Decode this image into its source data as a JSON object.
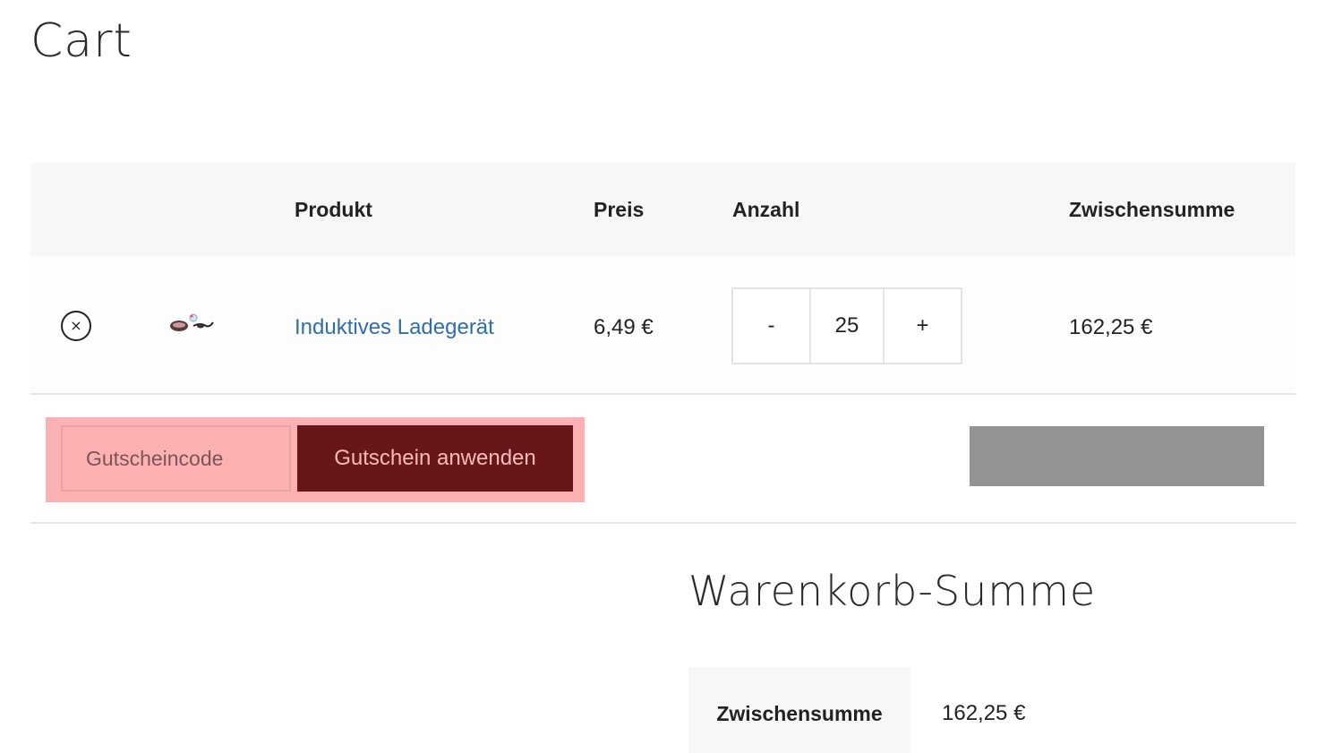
{
  "page": {
    "title": "Cart"
  },
  "cart_table": {
    "headers": {
      "product": "Produkt",
      "price": "Preis",
      "quantity": "Anzahl",
      "subtotal": "Zwischensumme"
    },
    "rows": [
      {
        "remove_icon": "close-circle-icon",
        "remove_symbol": "×",
        "product_name": "Induktives Ladegerät",
        "price": "6,49 €",
        "quantity": "25",
        "decrement_label": "-",
        "increment_label": "+",
        "subtotal": "162,25 €"
      }
    ]
  },
  "coupon": {
    "placeholder": "Gutscheincode",
    "apply_label": "Gutschein anwenden"
  },
  "totals": {
    "title": "Warenkorb-Summe",
    "subtotal_label": "Zwischensumme",
    "subtotal_value": "162,25 €"
  },
  "colors": {
    "link": "#2f6fa6",
    "coupon_highlight": "#feb1b3",
    "coupon_button": "#681619",
    "coupon_button_text": "#f8bcbc",
    "update_button": "#939393",
    "header_bg": "#f7f7f7"
  }
}
